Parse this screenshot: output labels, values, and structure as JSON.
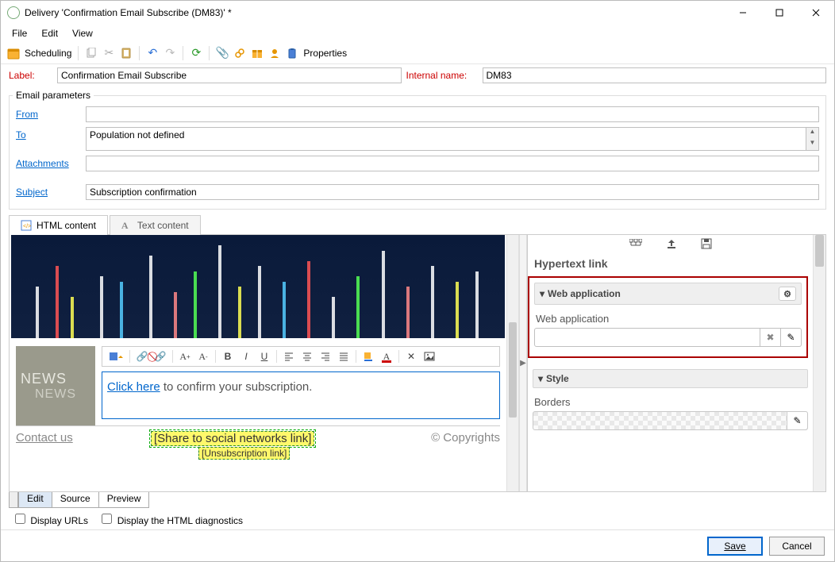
{
  "window": {
    "title": "Delivery 'Confirmation Email Subscribe (DM83)' *"
  },
  "menu": {
    "file": "File",
    "edit": "Edit",
    "view": "View"
  },
  "toolbar": {
    "scheduling": "Scheduling",
    "properties": "Properties"
  },
  "form": {
    "label_key": "Label:",
    "label_val": "Confirmation Email Subscribe",
    "intname_key": "Internal name:",
    "intname_val": "DM83"
  },
  "email_params": {
    "legend": "Email parameters",
    "from": "From",
    "to": "To",
    "to_val": "Population not defined",
    "attachments": "Attachments",
    "subject": "Subject",
    "subject_val": "Subscription confirmation"
  },
  "content_tabs": {
    "html": "HTML content",
    "text": "Text content"
  },
  "email_body": {
    "link_text": "Click here",
    "confirm_text": " to confirm your subscription.",
    "news1": "NEWS",
    "news2": "NEWS",
    "contact": "Contact us",
    "share_tag": "[Share to social networks link]",
    "unsub_tag": "[Unsubscription link]",
    "copy": "© Copyrights"
  },
  "right_panel": {
    "title": "Hypertext link",
    "webapp_hdr": "Web application",
    "webapp_field": "Web application",
    "style_hdr": "Style",
    "borders": "Borders"
  },
  "bottom_tabs": {
    "edit": "Edit",
    "source": "Source",
    "preview": "Preview"
  },
  "checks": {
    "display_urls": "Display URLs",
    "diag": "Display the HTML diagnostics"
  },
  "footer": {
    "save": "Save",
    "cancel": "Cancel"
  }
}
